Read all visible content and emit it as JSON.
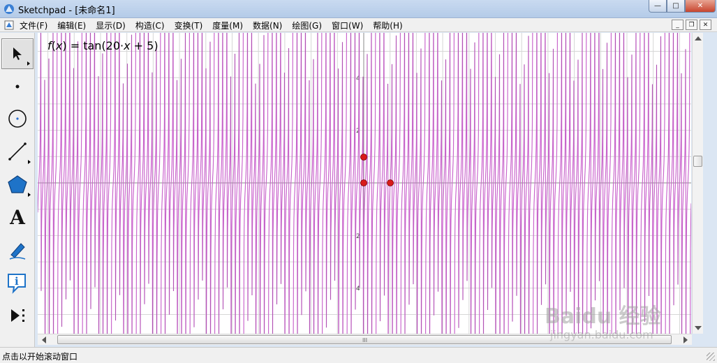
{
  "window": {
    "title": "Sketchpad  - [未命名1]",
    "controls": {
      "minimize": "—",
      "maximize": "□",
      "close": "✕"
    }
  },
  "menu": {
    "items": [
      "文件(F)",
      "编辑(E)",
      "显示(D)",
      "构造(C)",
      "变换(T)",
      "度量(M)",
      "数据(N)",
      "绘图(G)",
      "窗口(W)",
      "帮助(H)"
    ],
    "doc_controls": {
      "minimize": "_",
      "restore": "❐",
      "close": "✕"
    }
  },
  "toolbox": {
    "tools": [
      {
        "name": "arrow-select-tool-icon",
        "active": true
      },
      {
        "name": "point-tool-icon"
      },
      {
        "name": "compass-tool-icon"
      },
      {
        "name": "straightedge-tool-icon"
      },
      {
        "name": "polygon-tool-icon"
      },
      {
        "name": "text-tool-icon",
        "glyph": "A"
      },
      {
        "name": "marker-tool-icon"
      },
      {
        "name": "information-tool-icon",
        "glyph": "i"
      },
      {
        "name": "custom-tool-icon"
      }
    ]
  },
  "graph": {
    "function_label": {
      "f": "f",
      "x": "x",
      "rest": " = tan(20·",
      "x2": "x",
      "tail": " + 5)"
    },
    "y_tick_labels": [
      "4",
      "2",
      "2",
      "4"
    ],
    "curve_color": "#e47ae7",
    "point_color": "#d81b1b",
    "grid_color": "#d6d6d6"
  },
  "scrollbars": {
    "grip": "III"
  },
  "status": {
    "text": "点击以开始滚动窗口"
  },
  "watermark": {
    "brand": "Baidu 经验",
    "url": "jingyan.baidu.com"
  }
}
